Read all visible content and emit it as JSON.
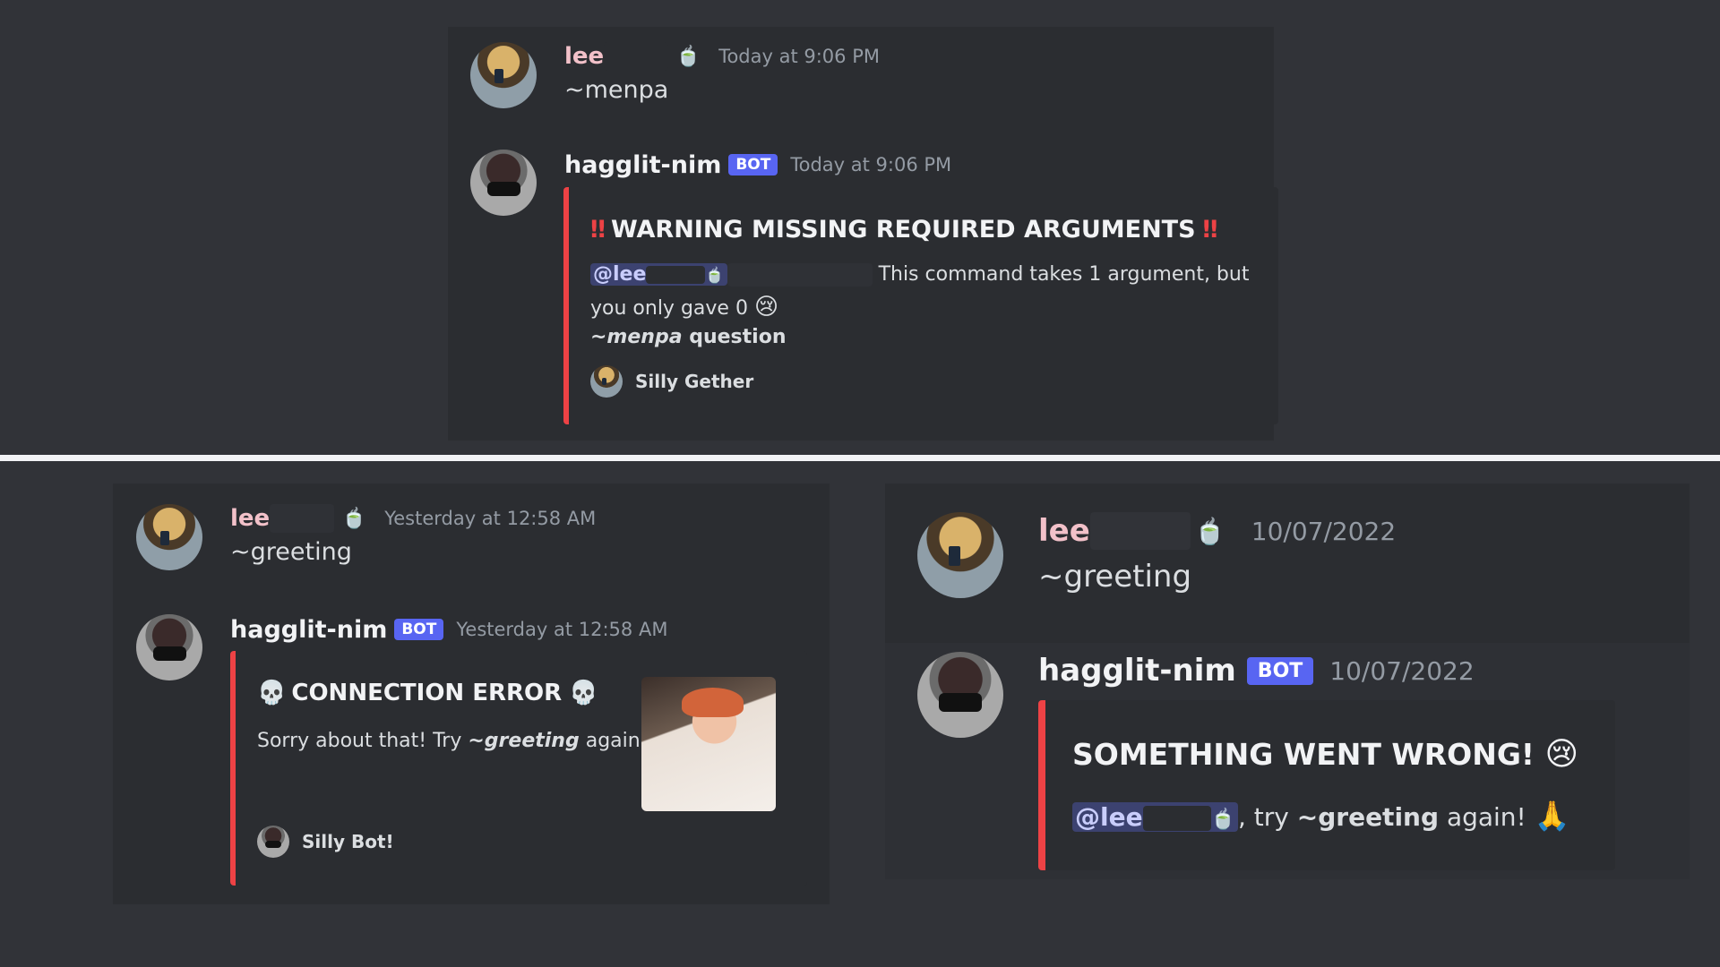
{
  "top": {
    "user_msg": {
      "username": "lee",
      "tea_emoji": "🍵",
      "timestamp": "Today at 9:06 PM",
      "content": "~menpa"
    },
    "bot_msg": {
      "username": "hagglit-nim",
      "bot_tag": "BOT",
      "timestamp": "Today at 9:06 PM",
      "embed": {
        "title_prefix_icon": "‼",
        "title": "WARNING MISSING REQUIRED ARGUMENTS",
        "title_suffix_icon": "‼",
        "mention": "@lee",
        "mention_emoji": "🍵",
        "line1_text": "This command takes 1 argument, but",
        "line2_text": "you only gave 0",
        "line2_emoji": "😢",
        "usage_cmd": "~menpa",
        "usage_arg": "question",
        "footer": "Silly Gether"
      }
    }
  },
  "bottom_left": {
    "user_msg": {
      "username": "lee",
      "tea_emoji": "🍵",
      "timestamp": "Yesterday at 12:58 AM",
      "content": "~greeting"
    },
    "bot_msg": {
      "username": "hagglit-nim",
      "bot_tag": "BOT",
      "timestamp": "Yesterday at 12:58 AM",
      "embed": {
        "title_icon": "💀",
        "title": "CONNECTION ERROR",
        "title_icon_end": "💀",
        "text_before": "Sorry about that! Try",
        "cmd": "~greeting",
        "text_after": "again",
        "footer": "Silly Bot!"
      }
    }
  },
  "bottom_right": {
    "user_msg": {
      "username": "lee",
      "tea_emoji": "🍵",
      "timestamp": "10/07/2022",
      "content": "~greeting"
    },
    "bot_msg": {
      "username": "hagglit-nim",
      "bot_tag": "BOT",
      "timestamp": "10/07/2022",
      "embed": {
        "title": "SOMETHING WENT WRONG!",
        "title_emoji": "😢",
        "mention": "@lee",
        "mention_emoji": "🍵",
        "text_before": ", try",
        "cmd": "~greeting",
        "text_after": "again!",
        "end_emoji": "🙏"
      }
    }
  },
  "colors": {
    "background": "#313338",
    "panel": "#2b2d31",
    "embed_border": "#ed4245",
    "bot_tag": "#5865f2",
    "username": "#f2c1c9"
  }
}
